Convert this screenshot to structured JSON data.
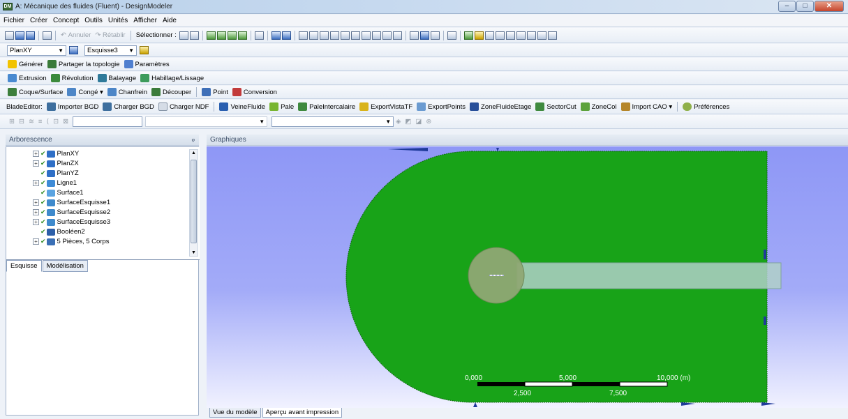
{
  "window": {
    "title": "A: Mécanique des fluides (Fluent) - DesignModeler",
    "logo": "DM"
  },
  "menu": [
    "Fichier",
    "Créer",
    "Concept",
    "Outils",
    "Unités",
    "Afficher",
    "Aide"
  ],
  "toolbar1": {
    "undo": "Annuler",
    "redo": "Rétablir",
    "select_label": "Sélectionner :"
  },
  "toolbar2": {
    "plane": "PlanXY",
    "sketch": "Esquisse3"
  },
  "toolbar3": {
    "generate": "Générer",
    "share_topology": "Partager la topologie",
    "parameters": "Paramètres"
  },
  "toolbar4": {
    "extrusion": "Extrusion",
    "revolution": "Révolution",
    "sweep": "Balayage",
    "skin": "Habillage/Lissage"
  },
  "toolbar5": {
    "shell": "Coque/Surface",
    "fillet": "Congé",
    "chamfer": "Chanfrein",
    "slice": "Découper",
    "point": "Point",
    "conversion": "Conversion"
  },
  "toolbar6": {
    "bladeeditor": "BladeEditor:",
    "import_bgd": "Importer BGD",
    "load_bgd": "Charger BGD",
    "load_ndf": "Charger NDF",
    "flow_path": "VeineFluide",
    "blade": "Pale",
    "splitter": "PaleIntercalaire",
    "export_vistatf": "ExportVistaTF",
    "export_points": "ExportPoints",
    "stage_zone": "ZoneFluideEtage",
    "sector_cut": "SectorCut",
    "neck_zone": "ZoneCol",
    "import_cad": "Import CAO",
    "preferences": "Préférences"
  },
  "tree": {
    "header": "Arborescence",
    "pin": "ᵩ",
    "items": [
      "PlanXY",
      "PlanZX",
      "PlanYZ",
      "Ligne1",
      "Surface1",
      "SurfaceEsquisse1",
      "SurfaceEsquisse2",
      "SurfaceEsquisse3",
      "Booléen2",
      "5 Pièces, 5 Corps"
    ],
    "tabs": [
      "Esquisse",
      "Modélisation"
    ]
  },
  "graphics": {
    "header": "Graphiques",
    "scale_labels_top": [
      "0,000",
      "5,000",
      "10,000 (m)"
    ],
    "scale_labels_bottom": [
      "2,500",
      "7,500"
    ]
  },
  "bottom_tabs": [
    "Vue du modèle",
    "Aperçu avant impression"
  ],
  "colors": {
    "domain_green": "#18a318",
    "background_top": "#8e97f6",
    "cylinder": "#8fa874",
    "channel": "#b0d0c8"
  }
}
